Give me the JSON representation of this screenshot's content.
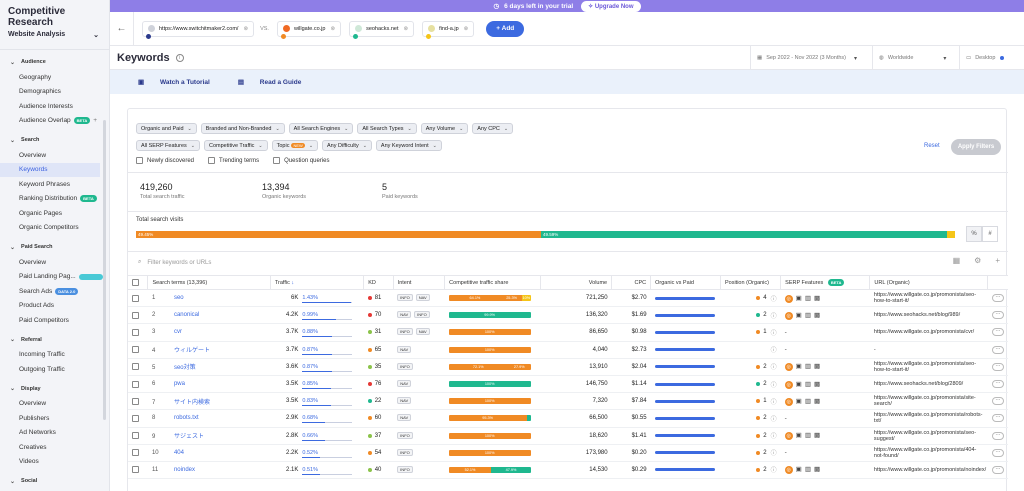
{
  "sidebar": {
    "title": "Competitive Research",
    "website_analysis": "Website Analysis",
    "sections": [
      {
        "label": "Audience",
        "items": [
          {
            "label": "Geography"
          },
          {
            "label": "Demographics"
          },
          {
            "label": "Audience Interests"
          },
          {
            "label": "Audience Overlap",
            "badge": "BETA"
          }
        ]
      },
      {
        "label": "Search",
        "items": [
          {
            "label": "Overview"
          },
          {
            "label": "Keywords",
            "active": true
          },
          {
            "label": "Keyword Phrases"
          },
          {
            "label": "Ranking Distribution",
            "badge": "BETA"
          },
          {
            "label": "Organic Pages"
          },
          {
            "label": "Organic Competitors"
          }
        ]
      },
      {
        "label": "Paid Search",
        "items": [
          {
            "label": "Overview"
          },
          {
            "label": "Paid Landing Pag..."
          },
          {
            "label": "Search Ads",
            "badge": "DATA 2.0"
          },
          {
            "label": "Product Ads"
          },
          {
            "label": "Paid Competitors"
          }
        ]
      },
      {
        "label": "Referral",
        "items": [
          {
            "label": "Incoming Traffic"
          },
          {
            "label": "Outgoing Traffic"
          }
        ]
      },
      {
        "label": "Display",
        "items": [
          {
            "label": "Overview"
          },
          {
            "label": "Publishers"
          },
          {
            "label": "Ad Networks"
          },
          {
            "label": "Creatives"
          },
          {
            "label": "Videos"
          }
        ]
      },
      {
        "label": "Social",
        "items": []
      }
    ]
  },
  "banner": {
    "text": "6 days left in your trial",
    "upgrade": "Upgrade Now"
  },
  "domains": {
    "d1": "https://www.switchitmaker2.com/",
    "vs": "VS.",
    "d2": "willgate.co.jp",
    "d3": "seohacks.net",
    "d4": "find-a.jp",
    "add": "+ Add"
  },
  "header": {
    "title": "Keywords",
    "date_range": "Sep 2022 - Nov 2022 (3 Months)",
    "region": "Worldwide",
    "device": "Desktop"
  },
  "guide": {
    "tutorial": "Watch a Tutorial",
    "read": "Read a Guide"
  },
  "filters": {
    "row1": [
      "Organic and Paid",
      "Branded and Non-Branded",
      "All Search Engines",
      "All Search Types",
      "Any Volume",
      "Any CPC"
    ],
    "row2": [
      "All SERP Features",
      "Competitive Traffic",
      "Topic",
      "Any Difficulty",
      "Any Keyword Intent"
    ],
    "topic_badge": "NEW",
    "checkboxes": [
      "Newly discovered",
      "Trending terms",
      "Question queries"
    ],
    "reset": "Reset",
    "apply": "Apply Filters"
  },
  "stats": [
    {
      "value": "419,260",
      "label": "Total search traffic"
    },
    {
      "value": "13,394",
      "label": "Organic keywords"
    },
    {
      "value": "5",
      "label": "Paid keywords"
    }
  ],
  "search_visits": {
    "label": "Total search visits",
    "segments": [
      {
        "pct": 49.45,
        "label": "49.45%",
        "color": "#f08a24"
      },
      {
        "pct": 49.59,
        "label": "49.59%",
        "color": "#1fb88f"
      },
      {
        "pct": 0.96,
        "label": "",
        "color": "#f5c518"
      }
    ],
    "toggle_pct": "%",
    "toggle_num": "#"
  },
  "search": {
    "placeholder": "Filter keywords or URLs"
  },
  "table": {
    "headers": {
      "terms": "Search terms (13,396)",
      "traffic": "Traffic",
      "kd": "KD",
      "intent": "Intent",
      "cts": "Competitive traffic share",
      "volume": "Volume",
      "cpc": "CPC",
      "ovp": "Organic vs Paid",
      "pos": "Position (Organic)",
      "serp": "SERP Features",
      "serp_badge": "BETA",
      "url": "URL (Organic)"
    },
    "rows": [
      {
        "n": "1",
        "kw": "seo",
        "traffic": "6K",
        "pct": "1.43%",
        "pctv": 1.43,
        "kd": "81",
        "kdc": "#e53935",
        "intent": [
          "INFO",
          "NAV"
        ],
        "cts": [
          {
            "w": 64.1,
            "c": "#f08a24",
            "t": "64.1%"
          },
          {
            "w": 25.3,
            "c": "#f08a24",
            "t": "25.3%"
          },
          {
            "w": 10.6,
            "c": "#f5c518",
            "t": "10%"
          }
        ],
        "volume": "721,250",
        "cpc": "$2.70",
        "pos": "4",
        "posc": "#f08a24",
        "serp": true,
        "url": "https://www.willgate.co.jp/promonista/seo-how-to-start-it/"
      },
      {
        "n": "2",
        "kw": "canonical",
        "traffic": "4.2K",
        "pct": "0.99%",
        "pctv": 0.99,
        "kd": "70",
        "kdc": "#e53935",
        "intent": [
          "NAV",
          "INFO"
        ],
        "cts": [
          {
            "w": 100,
            "c": "#1fb88f",
            "t": "99.9%"
          }
        ],
        "volume": "136,320",
        "cpc": "$1.69",
        "pos": "2",
        "posc": "#1fb88f",
        "serp": true,
        "url": "https://www.seohacks.net/blog/989/"
      },
      {
        "n": "3",
        "kw": "cvr",
        "traffic": "3.7K",
        "pct": "0.88%",
        "pctv": 0.88,
        "kd": "31",
        "kdc": "#8bc34a",
        "intent": [
          "INFO",
          "NAV"
        ],
        "cts": [
          {
            "w": 100,
            "c": "#f08a24",
            "t": "100%"
          }
        ],
        "volume": "86,650",
        "cpc": "$0.98",
        "pos": "1",
        "posc": "#f08a24",
        "serp": false,
        "url": "https://www.willgate.co.jp/promonista/cvr/"
      },
      {
        "n": "4",
        "kw": "ウィルゲート",
        "traffic": "3.7K",
        "pct": "0.87%",
        "pctv": 0.87,
        "kd": "65",
        "kdc": "#f08a24",
        "intent": [
          "NAV"
        ],
        "cts": [
          {
            "w": 100,
            "c": "#f08a24",
            "t": "100%"
          }
        ],
        "volume": "4,040",
        "cpc": "$2.73",
        "pos": "",
        "posc": "#ffffff",
        "serp": false,
        "url": "-"
      },
      {
        "n": "5",
        "kw": "seo対策",
        "traffic": "3.6K",
        "pct": "0.87%",
        "pctv": 0.87,
        "kd": "35",
        "kdc": "#8bc34a",
        "intent": [
          "INFO"
        ],
        "cts": [
          {
            "w": 72.1,
            "c": "#f08a24",
            "t": "72.1%"
          },
          {
            "w": 27.9,
            "c": "#f08a24",
            "t": "27.9%"
          }
        ],
        "volume": "13,910",
        "cpc": "$2.04",
        "pos": "2",
        "posc": "#f08a24",
        "serp": true,
        "url": "https://www.willgate.co.jp/promonista/seo-how-to-start-it/"
      },
      {
        "n": "6",
        "kw": "pwa",
        "traffic": "3.5K",
        "pct": "0.85%",
        "pctv": 0.85,
        "kd": "76",
        "kdc": "#e53935",
        "intent": [
          "NAV"
        ],
        "cts": [
          {
            "w": 100,
            "c": "#1fb88f",
            "t": "100%"
          }
        ],
        "volume": "146,750",
        "cpc": "$1.14",
        "pos": "2",
        "posc": "#1fb88f",
        "serp": true,
        "url": "https://www.seohacks.net/blog/2809/"
      },
      {
        "n": "7",
        "kw": "サイト内検索",
        "traffic": "3.5K",
        "pct": "0.83%",
        "pctv": 0.83,
        "kd": "22",
        "kdc": "#1fb88f",
        "intent": [
          "NAV"
        ],
        "cts": [
          {
            "w": 100,
            "c": "#f08a24",
            "t": "100%"
          }
        ],
        "volume": "7,320",
        "cpc": "$7.84",
        "pos": "1",
        "posc": "#f08a24",
        "serp": true,
        "url": "https://www.willgate.co.jp/promonista/site-search/"
      },
      {
        "n": "8",
        "kw": "robots.txt",
        "traffic": "2.9K",
        "pct": "0.68%",
        "pctv": 0.68,
        "kd": "60",
        "kdc": "#f08a24",
        "intent": [
          "NAV"
        ],
        "cts": [
          {
            "w": 95,
            "c": "#f08a24",
            "t": "95.3%"
          },
          {
            "w": 5,
            "c": "#1fb88f",
            "t": ""
          }
        ],
        "volume": "66,500",
        "cpc": "$0.55",
        "pos": "2",
        "posc": "#f08a24",
        "serp": false,
        "url": "https://www.willgate.co.jp/promonista/robots-txt/"
      },
      {
        "n": "9",
        "kw": "サジェスト",
        "traffic": "2.8K",
        "pct": "0.66%",
        "pctv": 0.66,
        "kd": "37",
        "kdc": "#8bc34a",
        "intent": [
          "INFO"
        ],
        "cts": [
          {
            "w": 100,
            "c": "#f08a24",
            "t": "100%"
          }
        ],
        "volume": "18,620",
        "cpc": "$1.41",
        "pos": "2",
        "posc": "#f08a24",
        "serp": true,
        "url": "https://www.willgate.co.jp/promonista/seo-suggest/"
      },
      {
        "n": "10",
        "kw": "404",
        "traffic": "2.2K",
        "pct": "0.52%",
        "pctv": 0.52,
        "kd": "54",
        "kdc": "#f08a24",
        "intent": [
          "INFO"
        ],
        "cts": [
          {
            "w": 100,
            "c": "#f08a24",
            "t": "100%"
          }
        ],
        "volume": "173,980",
        "cpc": "$0.20",
        "pos": "2",
        "posc": "#f08a24",
        "serp": false,
        "url": "https://www.willgate.co.jp/promonista/404-not-found/"
      },
      {
        "n": "11",
        "kw": "noindex",
        "traffic": "2.1K",
        "pct": "0.51%",
        "pctv": 0.51,
        "kd": "40",
        "kdc": "#8bc34a",
        "intent": [
          "INFO"
        ],
        "cts": [
          {
            "w": 52.1,
            "c": "#f08a24",
            "t": "52.1%"
          },
          {
            "w": 47.9,
            "c": "#1fb88f",
            "t": "47.9%"
          }
        ],
        "volume": "14,530",
        "cpc": "$0.29",
        "pos": "2",
        "posc": "#f08a24",
        "serp": true,
        "url": "https://www.willgate.co.jp/promonista/noindex/"
      }
    ]
  }
}
